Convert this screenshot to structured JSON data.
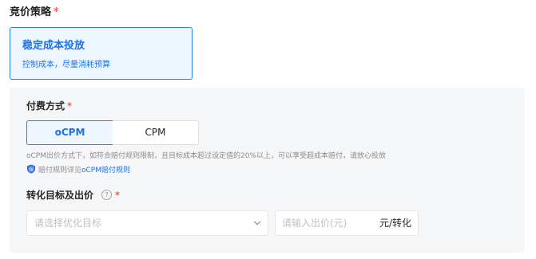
{
  "bidding_strategy": {
    "label": "竞价策略",
    "required_mark": "*",
    "option": {
      "title": "稳定成本投放",
      "subtitle": "控制成本，尽量消耗预算"
    }
  },
  "payment_method": {
    "label": "付费方式",
    "required_mark": "*",
    "options": [
      "oCPM",
      "CPM"
    ],
    "selected": "oCPM",
    "description": "oCPM出价方式下，如符合赔付规则限制，且目标成本超过设定值的20%以上，可以享受超成本赔付，请放心投放",
    "rule_prefix": "赔付规则详见",
    "rule_link": "oCPM赔付规则"
  },
  "conversion": {
    "label": "转化目标及出价",
    "help_glyph": "?",
    "required_mark": "*",
    "target_placeholder": "请选择优化目标",
    "bid_placeholder": "请输入出价(元)",
    "bid_unit": "元/转化"
  },
  "colors": {
    "accent": "#1a73e8",
    "required": "#f5222d",
    "panel_bg": "#f5f6f8"
  },
  "icons": {
    "shield": "shield-icon",
    "help": "help-circle-icon",
    "chevron": "chevron-down-icon"
  }
}
